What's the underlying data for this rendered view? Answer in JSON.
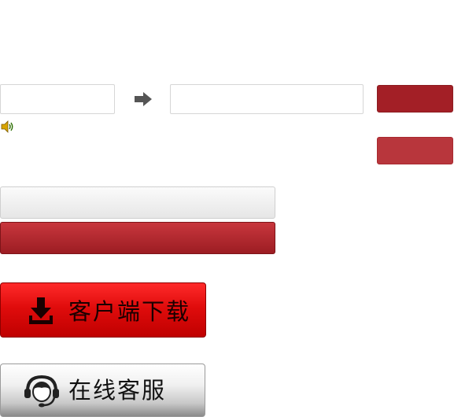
{
  "translate": {
    "source_value": "",
    "target_value": "",
    "arrow_icon": "right-arrow-icon",
    "speaker_icon": "speaker-icon",
    "translate_button_label": "",
    "secondary_button_label": ""
  },
  "bars": {
    "gray_bar_label": "",
    "red_bar_label": ""
  },
  "client_download": {
    "label": "客户端下载",
    "icon": "download-icon"
  },
  "online_service": {
    "label": "在线客服",
    "icon": "headset-icon"
  },
  "colors": {
    "accent_red": "#a31f26",
    "download_red": "#e00c0c"
  }
}
